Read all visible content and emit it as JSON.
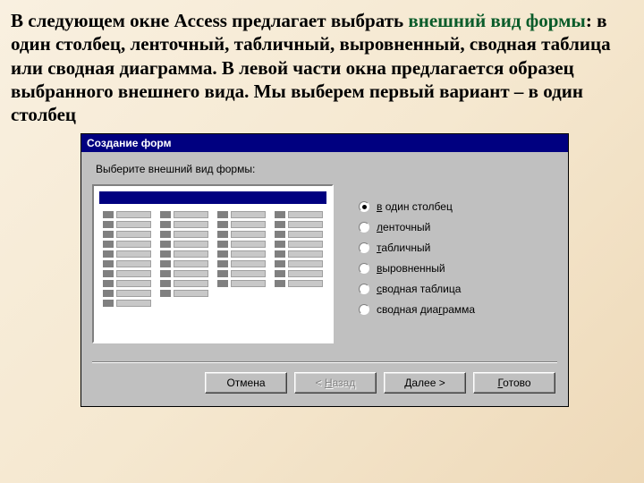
{
  "doc": {
    "pre": "В следующем окне Access предлагает выбрать ",
    "accent": "внешний вид формы",
    "post": ": в один столбец, ленточный, табличный, выровненный, сводная таблица или сводная диаграмма. В левой части окна предлагается образец выбранного внешнего вида. Мы выберем первый вариант – в один столбец"
  },
  "dialog": {
    "title": "Создание форм",
    "instruction": "Выберите внешний вид формы:",
    "options": [
      {
        "u": "в",
        "rest": " один столбец",
        "selected": true
      },
      {
        "u": "л",
        "rest": "енточный",
        "selected": false
      },
      {
        "u": "т",
        "rest": "абличный",
        "selected": false
      },
      {
        "u": "в",
        "rest": "ыровненный",
        "selected": false
      },
      {
        "u": "с",
        "rest": "водная таблица",
        "selected": false
      },
      {
        "pre": "сводная диа",
        "u": "г",
        "rest": "рамма",
        "selected": false
      }
    ],
    "buttons": {
      "cancel": "Отмена",
      "back_lt": "< ",
      "back_u": "Н",
      "back_rest": "азад",
      "next_u": "Д",
      "next_rest": "алее >",
      "finish_u": "Г",
      "finish_rest": "отово"
    }
  }
}
